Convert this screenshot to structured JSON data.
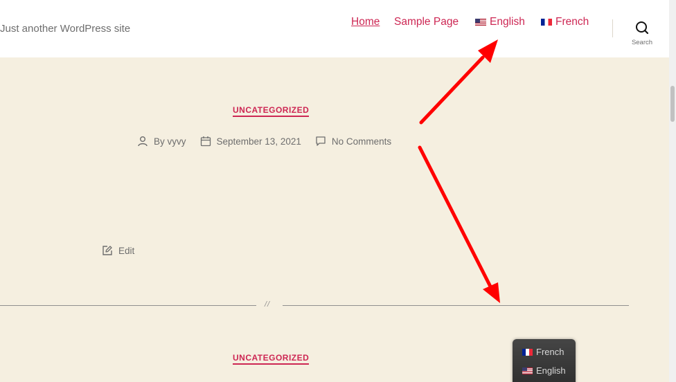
{
  "header": {
    "tagline": "Just another WordPress site",
    "nav": [
      {
        "label": "Home",
        "current": true
      },
      {
        "label": "Sample Page",
        "current": false
      },
      {
        "label": "English",
        "flag": "us-flag"
      },
      {
        "label": "French",
        "flag": "fr-flag"
      }
    ],
    "search_label": "Search"
  },
  "posts": [
    {
      "category": "UNCATEGORIZED",
      "author": "By vyvy",
      "date": "September 13, 2021",
      "comments": "No Comments",
      "edit_label": "Edit"
    },
    {
      "category": "UNCATEGORIZED"
    }
  ],
  "separator_mark": "//",
  "language_switcher_popup": {
    "items": [
      {
        "label": "French",
        "flag": "fr-flag"
      },
      {
        "label": "English",
        "flag": "us-flag"
      }
    ]
  },
  "colors": {
    "accent": "#cd2653",
    "background": "#f5efe0",
    "header_bg": "#ffffff",
    "annotation_arrow": "#ff0000"
  }
}
